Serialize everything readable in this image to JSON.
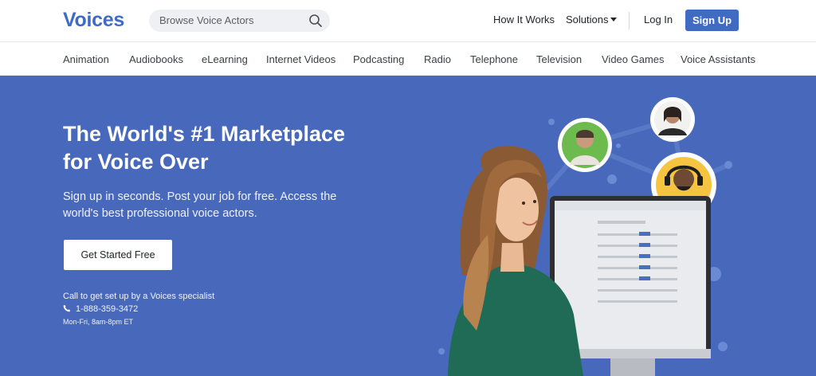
{
  "header": {
    "logo": "Voices",
    "search_placeholder": "Browse Voice Actors",
    "how_it_works": "How It Works",
    "solutions": "Solutions",
    "login": "Log In",
    "signup": "Sign Up"
  },
  "categories": [
    "Animation",
    "Audiobooks",
    "eLearning",
    "Internet Videos",
    "Podcasting",
    "Radio",
    "Telephone",
    "Television",
    "Video Games",
    "Voice Assistants"
  ],
  "hero": {
    "headline_line1": "The World's #1 Marketplace",
    "headline_line2": "for Voice Over",
    "subtext_line1": "Sign up in seconds. Post your job for free. Access the",
    "subtext_line2": "world's best professional voice actors.",
    "cta": "Get Started Free",
    "call_text": "Call to get set up by a Voices specialist",
    "phone": "1-888-359-3472",
    "hours": "Mon-Fri, 8am-8pm ET"
  },
  "icons": {
    "search": "search-icon",
    "phone": "phone-icon",
    "solutions_dropdown": "caret-down-icon"
  },
  "colors": {
    "brand": "#3f6bc2",
    "hero_bg": "#4869bb",
    "text_dark": "#22262b"
  }
}
